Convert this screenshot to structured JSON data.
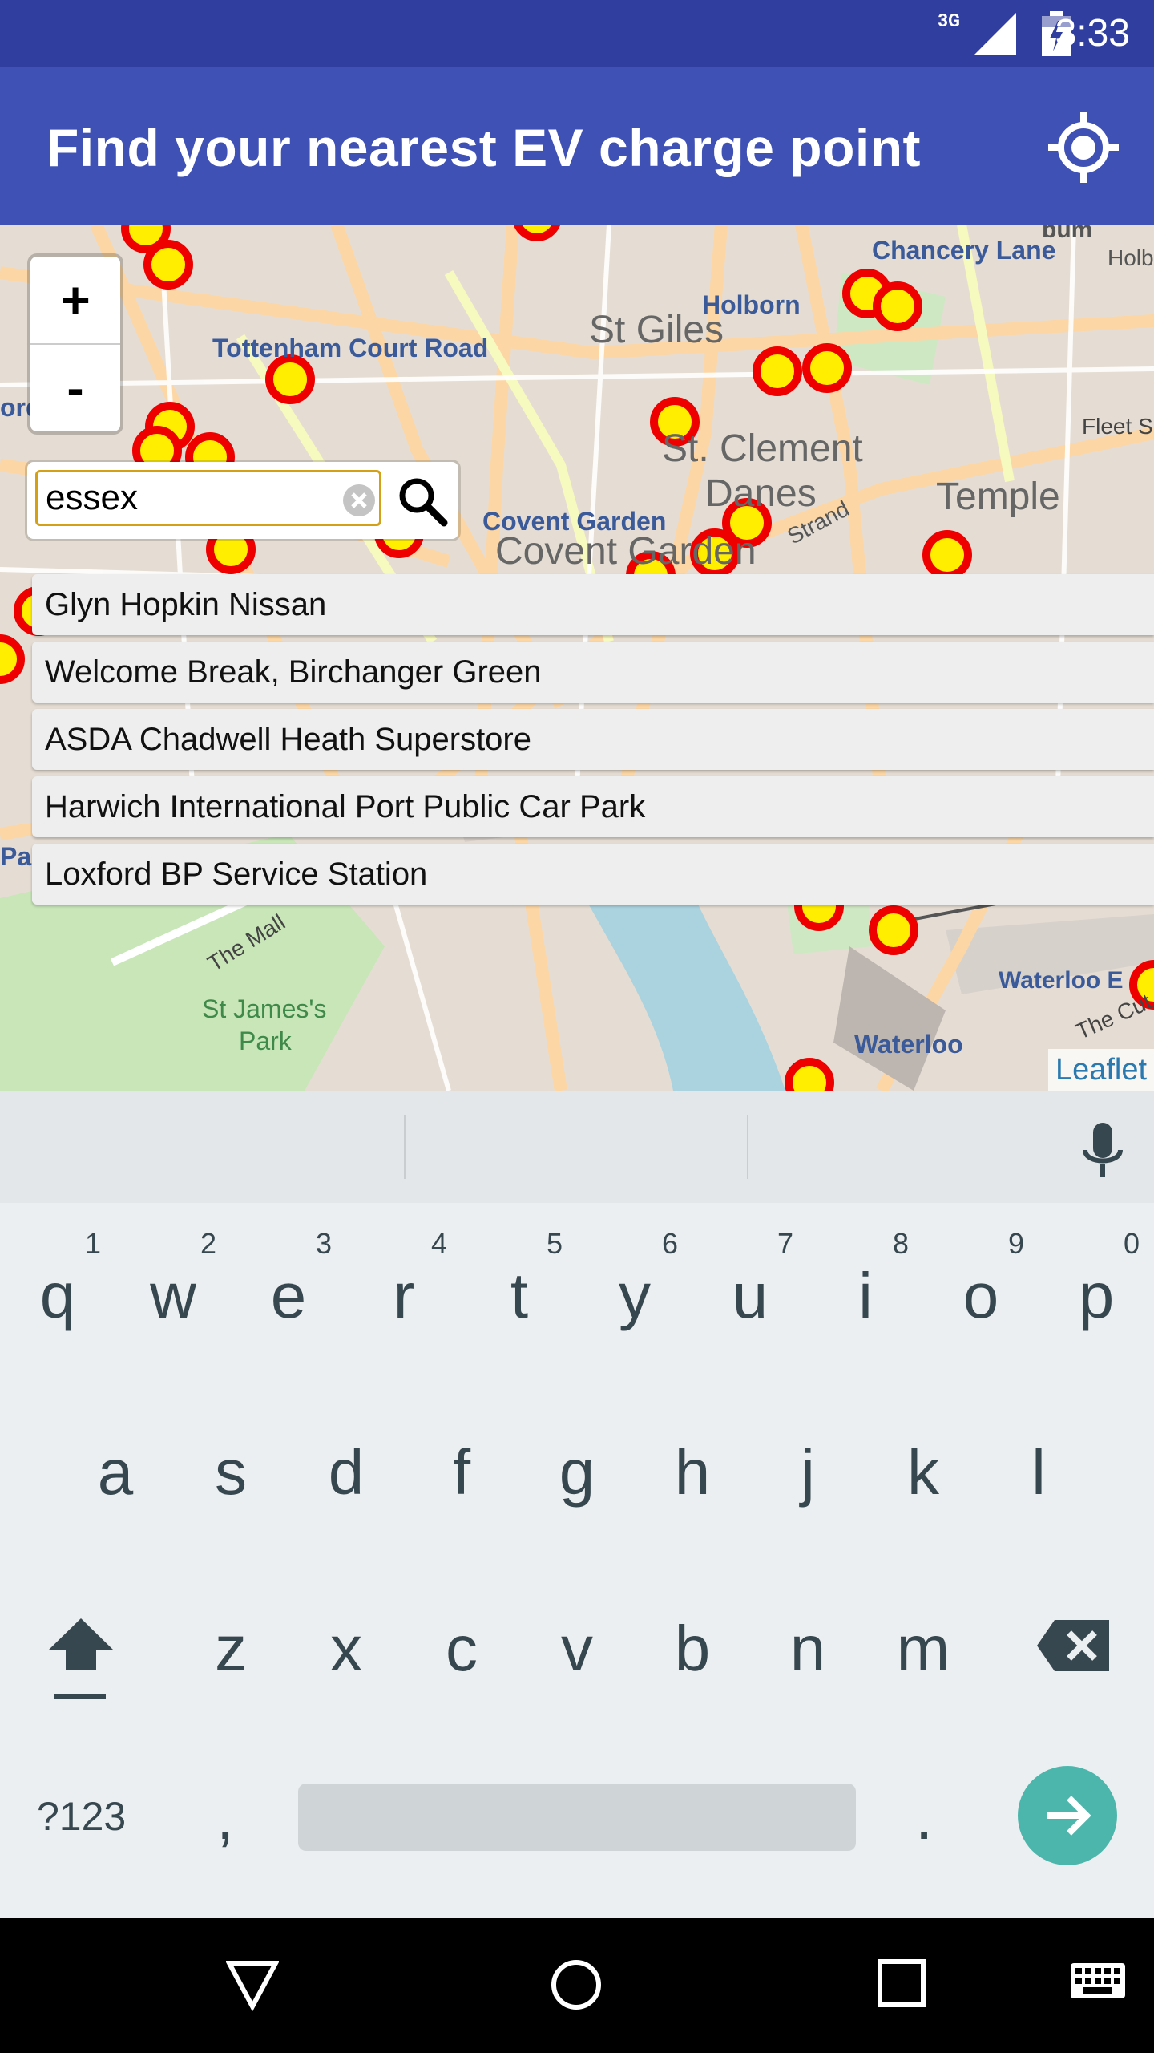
{
  "status_bar": {
    "network": "3G",
    "time": "3:33"
  },
  "app_bar": {
    "title": "Find your nearest EV charge point",
    "locate_icon": "my-location-icon"
  },
  "map": {
    "zoom_in_label": "+",
    "zoom_out_label": "-",
    "search": {
      "value": "essex",
      "clear_icon": "clear-icon",
      "search_icon": "search-icon"
    },
    "results": [
      "Glyn Hopkin Nissan",
      "Welcome Break, Birchanger Green",
      "ASDA Chadwell Heath Superstore",
      "Harwich International Port Public Car Park",
      "Loxford BP Service Station"
    ],
    "attribution": "Leaflet",
    "labels": {
      "chancery_lane": "Chancery Lane",
      "holborn": "Holborn",
      "st_giles": "St Giles",
      "tottenham": "Tottenham Court Road",
      "st_clement": "St. Clement",
      "danes": "Danes",
      "temple": "Temple",
      "fleet": "Fleet S",
      "covent_garden_station": "Covent Garden",
      "covent_garden": "Covent Garden",
      "strand": "Strand",
      "the_mall": "The Mall",
      "st_james": "St James's",
      "park": "Park",
      "waterloo_e": "Waterloo E",
      "waterloo": "Waterloo",
      "the_cut": "The Cut",
      "holb": "Holb",
      "bum": "bum",
      "ord": "ord",
      "par": "Par"
    },
    "marker_color_fill": "#ffee00",
    "marker_color_stroke": "#ee0000"
  },
  "keyboard": {
    "row1": [
      {
        "key": "q",
        "hint": "1"
      },
      {
        "key": "w",
        "hint": "2"
      },
      {
        "key": "e",
        "hint": "3"
      },
      {
        "key": "r",
        "hint": "4"
      },
      {
        "key": "t",
        "hint": "5"
      },
      {
        "key": "y",
        "hint": "6"
      },
      {
        "key": "u",
        "hint": "7"
      },
      {
        "key": "i",
        "hint": "8"
      },
      {
        "key": "o",
        "hint": "9"
      },
      {
        "key": "p",
        "hint": "0"
      }
    ],
    "row2": [
      "a",
      "s",
      "d",
      "f",
      "g",
      "h",
      "j",
      "k",
      "l"
    ],
    "row3": [
      "z",
      "x",
      "c",
      "v",
      "b",
      "n",
      "m"
    ],
    "symbols_label": "?123",
    "comma": ",",
    "period": ".",
    "enter_icon": "arrow-right-icon",
    "accent_color": "#4db6ac"
  },
  "nav_bar": {
    "back": "back-icon",
    "home": "home-icon",
    "recents": "recents-icon",
    "keyboard": "keyboard-icon"
  }
}
